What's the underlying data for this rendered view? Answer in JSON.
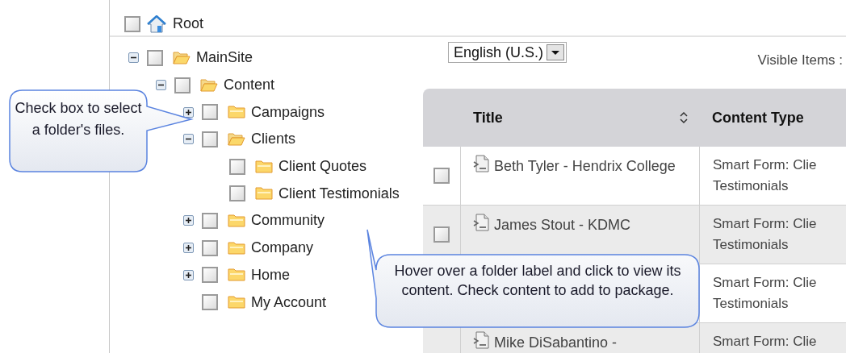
{
  "root": {
    "label": "Root",
    "checked": false
  },
  "language_select": {
    "value": "English (U.S.)"
  },
  "visible_items": {
    "label": "Visible Items :"
  },
  "tree": [
    {
      "label": "MainSite",
      "checked": false,
      "expanded": true,
      "children": [
        {
          "label": "Content",
          "checked": false,
          "expanded": true,
          "children": [
            {
              "label": "Campaigns",
              "checked": false,
              "expanded": false
            },
            {
              "label": "Clients",
              "checked": false,
              "expanded": true,
              "children": [
                {
                  "label": "Client Quotes",
                  "checked": false
                },
                {
                  "label": "Client Testimonials",
                  "checked": false
                }
              ]
            },
            {
              "label": "Community",
              "checked": false,
              "expanded": false
            },
            {
              "label": "Company",
              "checked": false,
              "expanded": false
            },
            {
              "label": "Home",
              "checked": false,
              "expanded": false
            },
            {
              "label": "My Account",
              "checked": false
            }
          ]
        }
      ]
    }
  ],
  "table": {
    "columns": [
      {
        "label": "Title",
        "sortable": true
      },
      {
        "label": "Content Type",
        "sortable": false
      }
    ],
    "rows": [
      {
        "checked": false,
        "title": "Beth Tyler - Hendrix College",
        "content_type": [
          "Smart Form: Clie",
          "Testimonials"
        ]
      },
      {
        "checked": false,
        "title": "James Stout - KDMC",
        "content_type": [
          "Smart Form: Clie",
          "Testimonials"
        ]
      },
      {
        "content_type": [
          "Smart Form: Clie",
          "Testimonials"
        ]
      },
      {
        "title": "Mike DiSabantino -",
        "content_type": [
          "Smart Form: Clie"
        ]
      }
    ]
  },
  "callouts": [
    {
      "text": "Check box to select a folder's files."
    },
    {
      "text": "Hover over a folder label and click to view its content. Check content to add to package."
    }
  ]
}
